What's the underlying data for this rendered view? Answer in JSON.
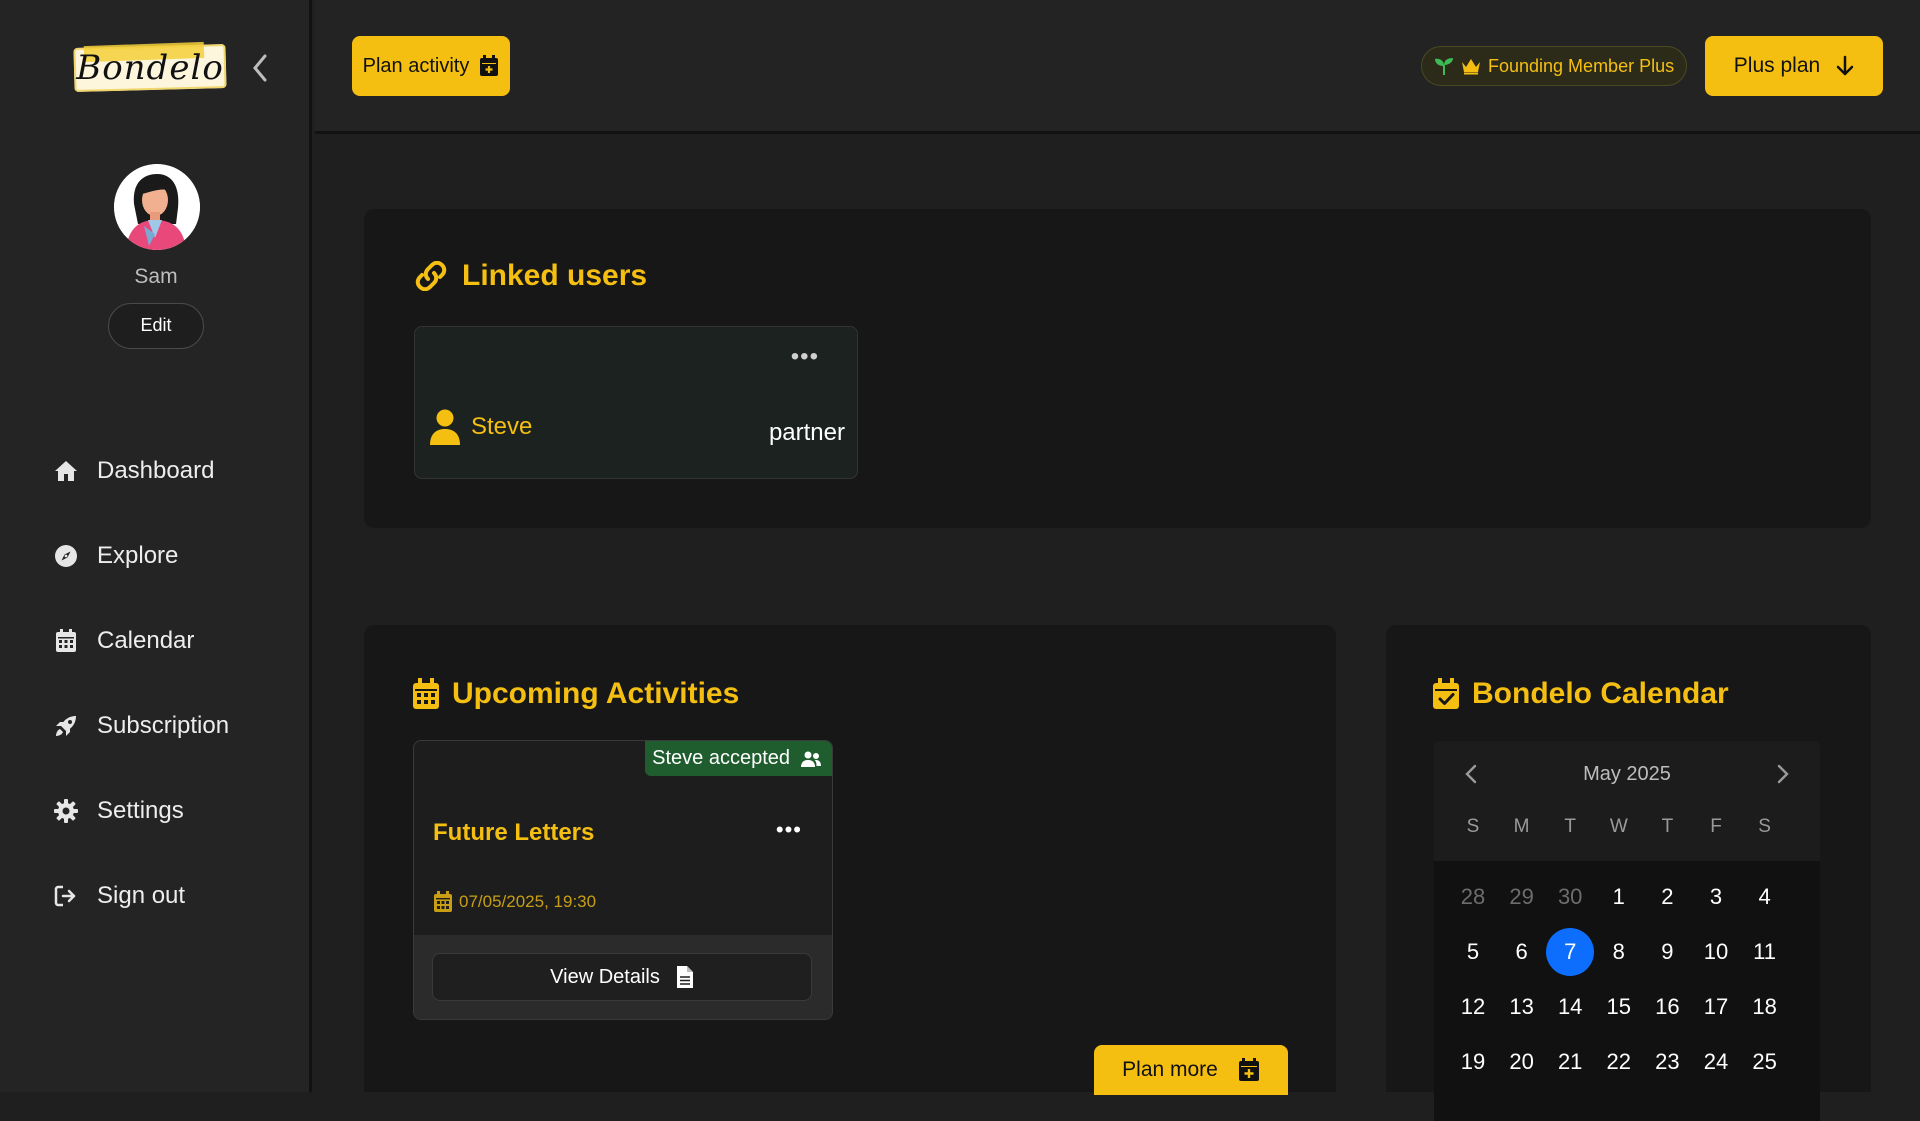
{
  "sidebar": {
    "logo_text": "Bondelo",
    "user_name": "Sam",
    "edit_label": "Edit",
    "items": [
      {
        "label": "Dashboard",
        "icon": "home-icon"
      },
      {
        "label": "Explore",
        "icon": "compass-icon"
      },
      {
        "label": "Calendar",
        "icon": "calendar-icon"
      },
      {
        "label": "Subscription",
        "icon": "rocket-icon"
      },
      {
        "label": "Settings",
        "icon": "gear-icon"
      },
      {
        "label": "Sign out",
        "icon": "sign-out-icon"
      }
    ]
  },
  "header": {
    "plan_activity_label": "Plan activity",
    "member_badge": "Founding Member Plus",
    "plus_plan_label": "Plus plan"
  },
  "linked_users": {
    "title": "Linked users",
    "users": [
      {
        "name": "Steve",
        "role": "partner"
      }
    ]
  },
  "upcoming": {
    "title": "Upcoming Activities",
    "activities": [
      {
        "status": "Steve accepted",
        "title": "Future Letters",
        "date": "07/05/2025, 19:30",
        "action": "View Details"
      }
    ],
    "plan_more_label": "Plan more"
  },
  "calendar": {
    "title": "Bondelo Calendar",
    "month": "May 2025",
    "weekdays": [
      "S",
      "M",
      "T",
      "W",
      "T",
      "F",
      "S"
    ],
    "weeks": [
      [
        "28",
        "29",
        "30",
        "1",
        "2",
        "3",
        "4"
      ],
      [
        "5",
        "6",
        "7",
        "8",
        "9",
        "10",
        "11"
      ],
      [
        "12",
        "13",
        "14",
        "15",
        "16",
        "17",
        "18"
      ],
      [
        "19",
        "20",
        "21",
        "22",
        "23",
        "24",
        "25"
      ]
    ],
    "selected_day": "7"
  },
  "colors": {
    "accent": "#f5bf12",
    "today": "#0d6efd",
    "accepted_badge": "#1f5d2e"
  }
}
